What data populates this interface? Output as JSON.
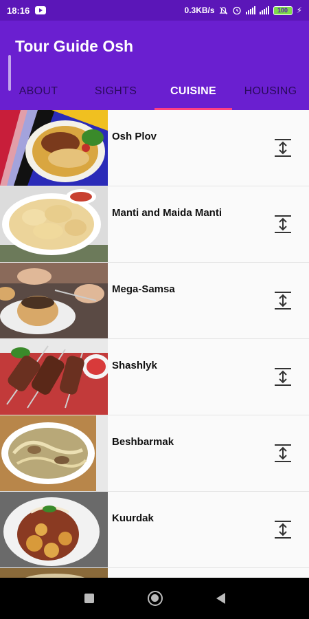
{
  "status_bar": {
    "time": "18:16",
    "network_speed": "0.3KB/s",
    "battery": "100",
    "icons": [
      "youtube-icon",
      "mute-icon",
      "alarm-icon",
      "signal-icon",
      "signal-icon",
      "battery-icon",
      "charging-icon"
    ]
  },
  "app_bar": {
    "title": "Tour Guide Osh",
    "tabs": [
      {
        "label": "ABOUT",
        "active": false
      },
      {
        "label": "SIGHTS",
        "active": false
      },
      {
        "label": "CUISINE",
        "active": true
      },
      {
        "label": "HOUSING",
        "active": false
      }
    ]
  },
  "cuisine_list": {
    "items": [
      {
        "name": "Osh Plov",
        "icon": "expand-icon"
      },
      {
        "name": "Manti and Maida Manti",
        "icon": "expand-icon"
      },
      {
        "name": "Mega-Samsa",
        "icon": "expand-icon"
      },
      {
        "name": "Shashlyk",
        "icon": "expand-icon"
      },
      {
        "name": "Beshbarmak",
        "icon": "expand-icon"
      },
      {
        "name": "Kuurdak",
        "icon": "expand-icon"
      }
    ]
  },
  "nav_bar": {
    "icons": [
      "recents-icon",
      "home-icon",
      "back-icon"
    ]
  },
  "colors": {
    "status_bar": "#5b16b8",
    "app_bar": "#6a1fd0",
    "tab_indicator": "#ff4081",
    "inactive_tab": "#2a0b5c"
  }
}
